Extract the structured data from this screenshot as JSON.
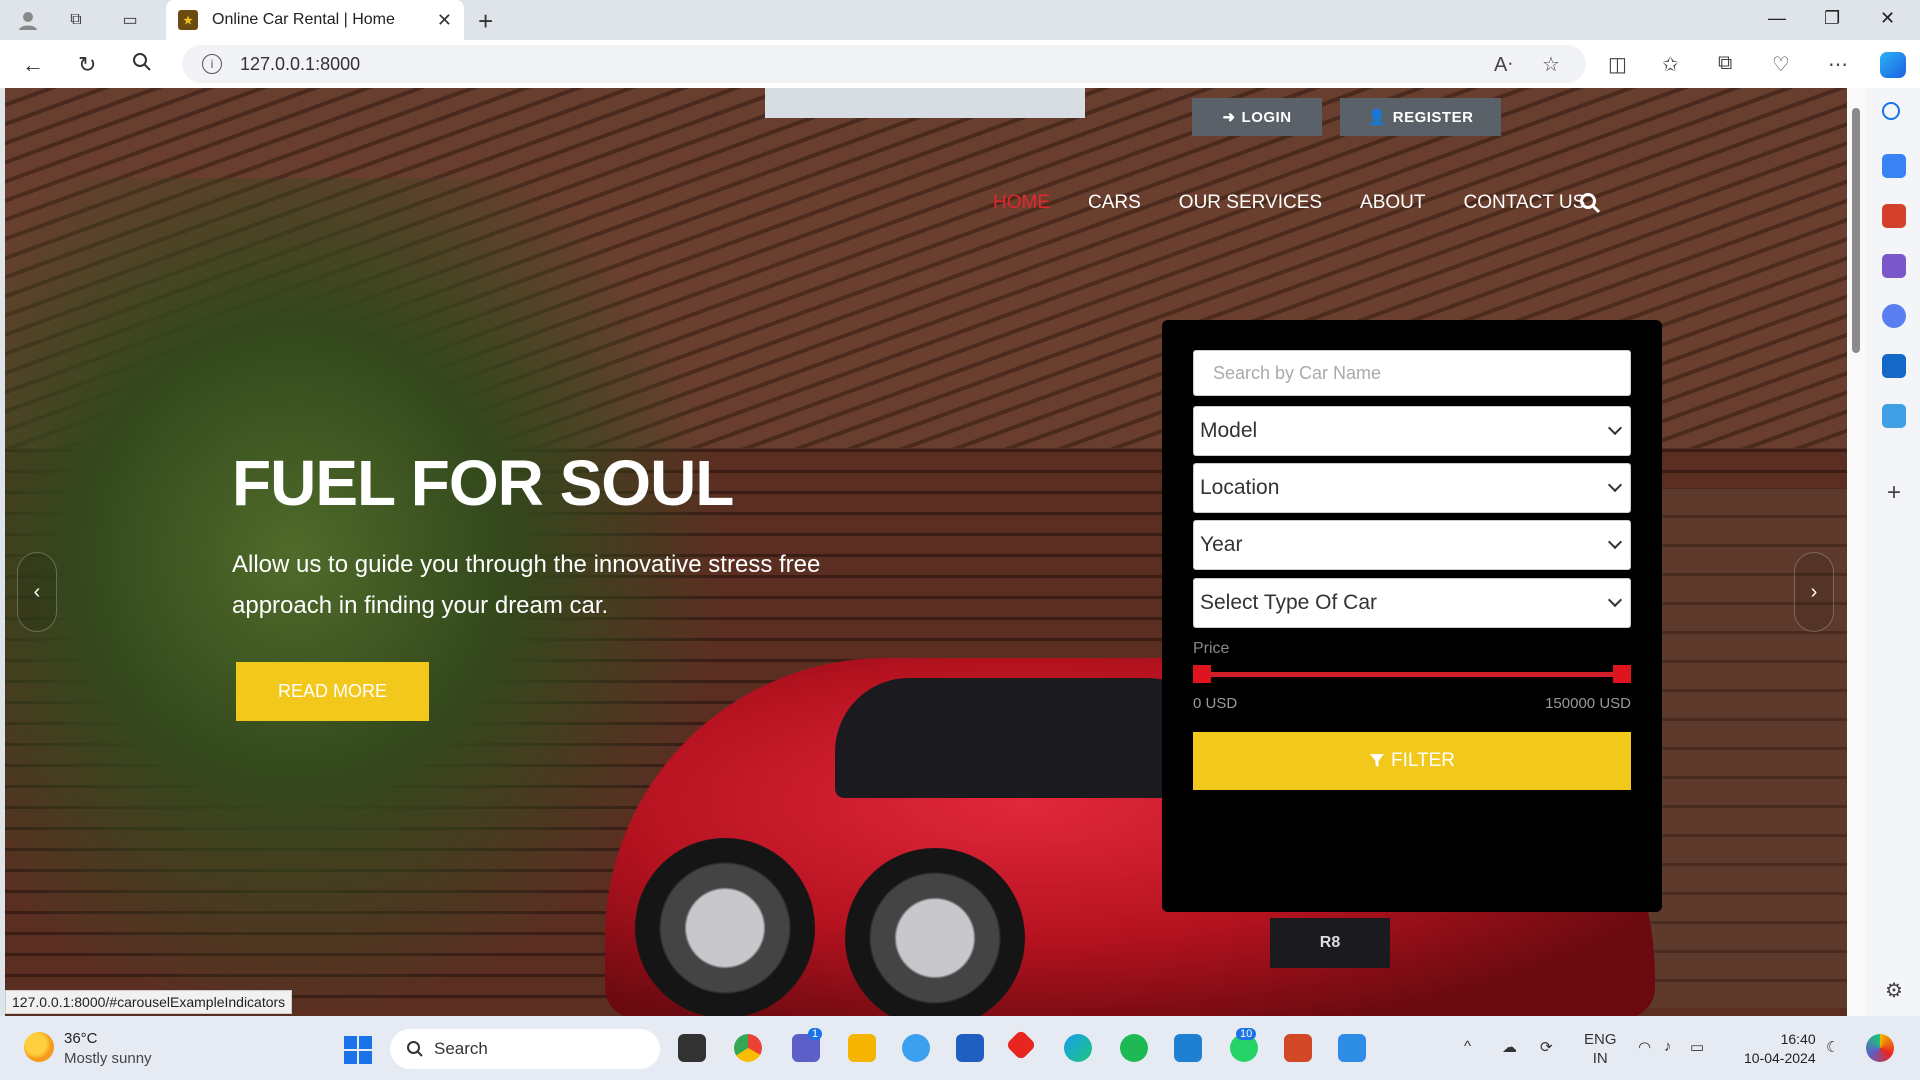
{
  "browser": {
    "tab_title": "Online Car Rental | Home",
    "url": "127.0.0.1:8000",
    "status_url": "127.0.0.1:8000/#carouselExampleIndicators"
  },
  "header": {
    "login_label": "LOGIN",
    "register_label": "REGISTER",
    "menu": [
      {
        "label": "HOME",
        "active": true
      },
      {
        "label": "CARS",
        "active": false
      },
      {
        "label": "OUR SERVICES",
        "active": false
      },
      {
        "label": "ABOUT",
        "active": false
      },
      {
        "label": "CONTACT US",
        "active": false
      }
    ]
  },
  "hero": {
    "title": "FUEL FOR SOUL",
    "subtitle": "Allow us to guide you through the innovative stress free approach in finding your dream car.",
    "read_more_label": "READ MORE",
    "plate_text": "R8"
  },
  "filter": {
    "search_placeholder": "Search by Car Name",
    "model": "Model",
    "location": "Location",
    "year": "Year",
    "car_type": "Select Type Of Car",
    "price_label": "Price",
    "price_min": "0 USD",
    "price_max": "150000 USD",
    "filter_label": "FILTER"
  },
  "taskbar": {
    "weather_temp": "36°C",
    "weather_desc": "Mostly sunny",
    "search_label": "Search",
    "lang": "ENG",
    "region": "IN",
    "time": "16:40",
    "date": "10-04-2024",
    "teams_badge": "1",
    "whatsapp_badge": "10"
  },
  "colors": {
    "accent_yellow": "#f2c81c",
    "accent_red": "#e3262e",
    "panel_black": "#000000"
  }
}
